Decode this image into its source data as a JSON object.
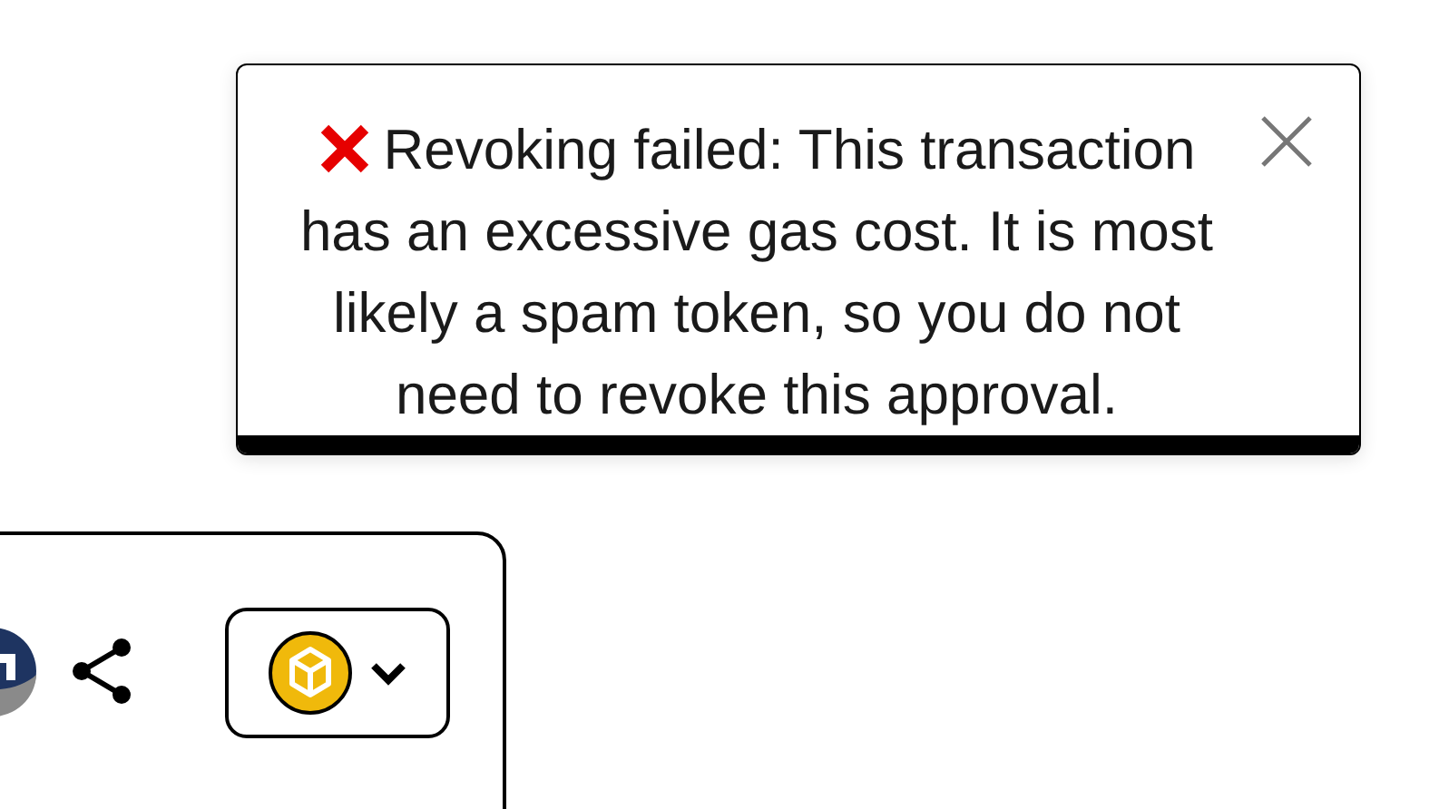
{
  "toast": {
    "kind": "error",
    "message": "Revoking failed: This transaction has an excessive gas cost. It is most likely a spam token, so you do not need to revoke this approval.",
    "progress": {
      "level": 1
    }
  },
  "card": {
    "network_button": {
      "expanded": false
    }
  }
}
